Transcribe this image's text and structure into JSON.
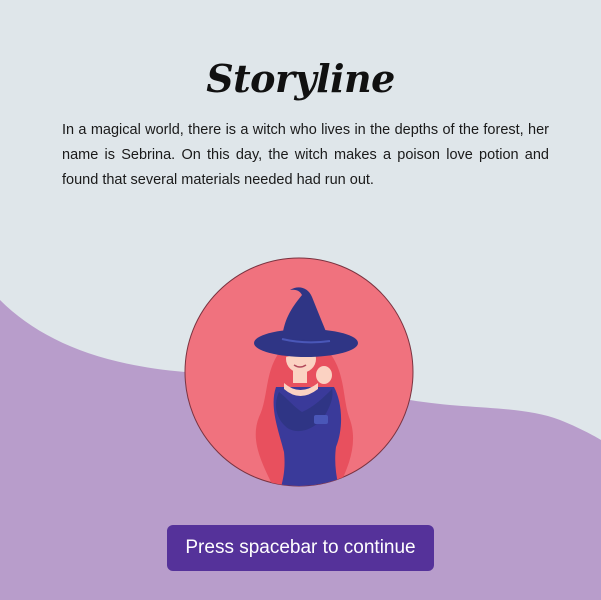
{
  "title": "Storyline",
  "story_text": "In a magical world, there is a witch who lives in the depths of the forest, her name is Sebrina. On this day, the witch makes a poison love potion and found that several materials needed had run out.",
  "continue_label": "Press spacebar to continue",
  "illustration": {
    "icon": "witch-portrait-icon",
    "subject": "witch"
  },
  "colors": {
    "background": "#dfe6ea",
    "wave": "#b89dcb",
    "circle": "#f0727e",
    "button": "#55329a",
    "button_text": "#ffffff",
    "witch_hat": "#2f3585",
    "witch_dress": "#3a3a9a",
    "witch_hair": "#e8505e"
  }
}
